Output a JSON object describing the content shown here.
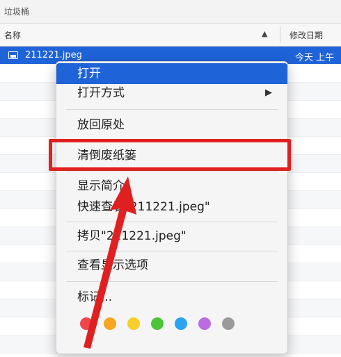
{
  "path_bar": {
    "text": "垃圾桶"
  },
  "columns": {
    "name": "名称",
    "sort_glyph": "▲",
    "date": "修改日期"
  },
  "selected_file": {
    "name": "211221.jpeg",
    "date": "今天 上午"
  },
  "context_menu": {
    "items": [
      {
        "label": "打开"
      },
      {
        "label": "打开方式"
      },
      {
        "label": "放回原处"
      },
      {
        "label": "清倒废纸篓"
      },
      {
        "label": "显示简介"
      },
      {
        "label": "快速查看\"211221.jpeg\""
      },
      {
        "label": "拷贝\"211221.jpeg\""
      },
      {
        "label": "查看显示选项"
      },
      {
        "label": "标记..."
      }
    ],
    "submenu_glyph": "▶"
  },
  "tags": [
    {
      "name": "red-tag",
      "color": "#f0454b"
    },
    {
      "name": "orange-tag",
      "color": "#f6a623"
    },
    {
      "name": "yellow-tag",
      "color": "#f5cf2a"
    },
    {
      "name": "green-tag",
      "color": "#4cc437"
    },
    {
      "name": "blue-tag",
      "color": "#2aa3f1"
    },
    {
      "name": "purple-tag",
      "color": "#bd6be0"
    },
    {
      "name": "gray-tag",
      "color": "#9a9a9a"
    }
  ],
  "colors": {
    "selection": "#1f63d8",
    "annotation": "#e02020"
  }
}
